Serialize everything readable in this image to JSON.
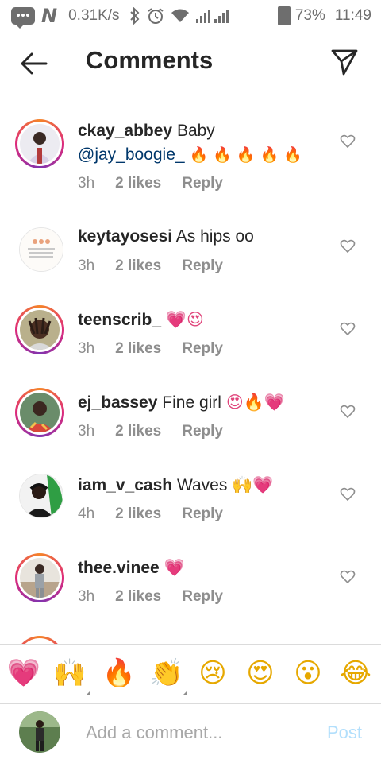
{
  "status_bar": {
    "speed": "0.31K/s",
    "battery": "73%",
    "time": "11:49",
    "icons": [
      "message-icon",
      "n-app-icon",
      "bluetooth-icon",
      "alarm-icon",
      "wifi-icon",
      "signal-icon",
      "battery-icon"
    ]
  },
  "header": {
    "title": "Comments",
    "back_icon": "arrow-left-icon",
    "share_icon": "paper-plane-icon"
  },
  "comments": [
    {
      "user": "ckay_abbey",
      "text": "Baby",
      "mention": "@jay_boogie_",
      "emoji": "🔥 🔥 🔥 🔥 🔥",
      "time": "3h",
      "likes": "2 likes",
      "reply": "Reply"
    },
    {
      "user": "keytayosesi",
      "text": "As hips oo",
      "mention": "",
      "emoji": "",
      "time": "3h",
      "likes": "2 likes",
      "reply": "Reply"
    },
    {
      "user": "teenscrib_",
      "text": "",
      "mention": "",
      "emoji": "💗😍",
      "time": "3h",
      "likes": "2 likes",
      "reply": "Reply"
    },
    {
      "user": "ej_bassey",
      "text": "Fine girl",
      "mention": "",
      "emoji": "😍🔥💗",
      "time": "3h",
      "likes": "2 likes",
      "reply": "Reply"
    },
    {
      "user": "iam_v_cash",
      "text": "Waves",
      "mention": "",
      "emoji": "🙌💗",
      "time": "4h",
      "likes": "2 likes",
      "reply": "Reply"
    },
    {
      "user": "thee.vinee",
      "text": "",
      "mention": "",
      "emoji": "💗",
      "time": "3h",
      "likes": "2 likes",
      "reply": "Reply"
    }
  ],
  "emoji_bar": [
    "💗",
    "🙌",
    "🔥",
    "👏",
    "😢",
    "😍",
    "😮",
    "😂"
  ],
  "input": {
    "placeholder": "Add a comment...",
    "post_label": "Post"
  },
  "colors": {
    "text": "#262626",
    "secondary": "#8e8e8e",
    "mention": "#00376b",
    "post_disabled": "#b2dffc",
    "heart": "#e0457b"
  }
}
